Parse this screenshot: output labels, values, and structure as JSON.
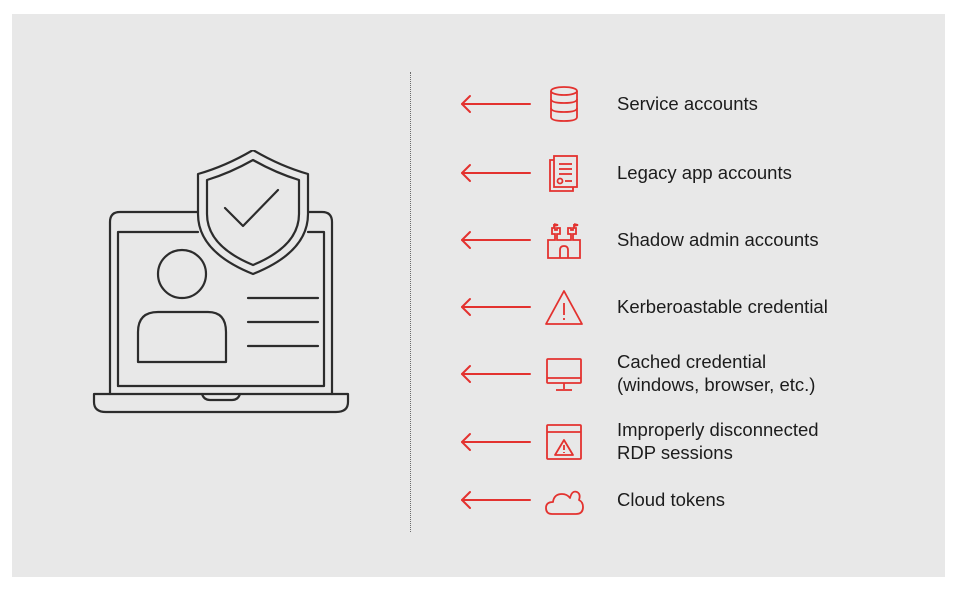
{
  "colors": {
    "panel": "#e8e8e8",
    "accent": "#e3322f",
    "line": "#2c2c2c",
    "text": "#1c1c1c"
  },
  "illustration": {
    "icon": "laptop-user-shield-icon"
  },
  "items": [
    {
      "icon": "database-icon",
      "label": "Service accounts"
    },
    {
      "icon": "document-icon",
      "label": "Legacy app accounts"
    },
    {
      "icon": "castle-icon",
      "label": "Shadow admin accounts"
    },
    {
      "icon": "warning-triangle-icon",
      "label": "Kerberoastable credential"
    },
    {
      "icon": "monitor-icon",
      "label": "Cached credential\n(windows, browser, etc.)"
    },
    {
      "icon": "window-warning-icon",
      "label": "Improperly disconnected\nRDP sessions"
    },
    {
      "icon": "cloud-icon",
      "label": "Cloud tokens"
    }
  ]
}
